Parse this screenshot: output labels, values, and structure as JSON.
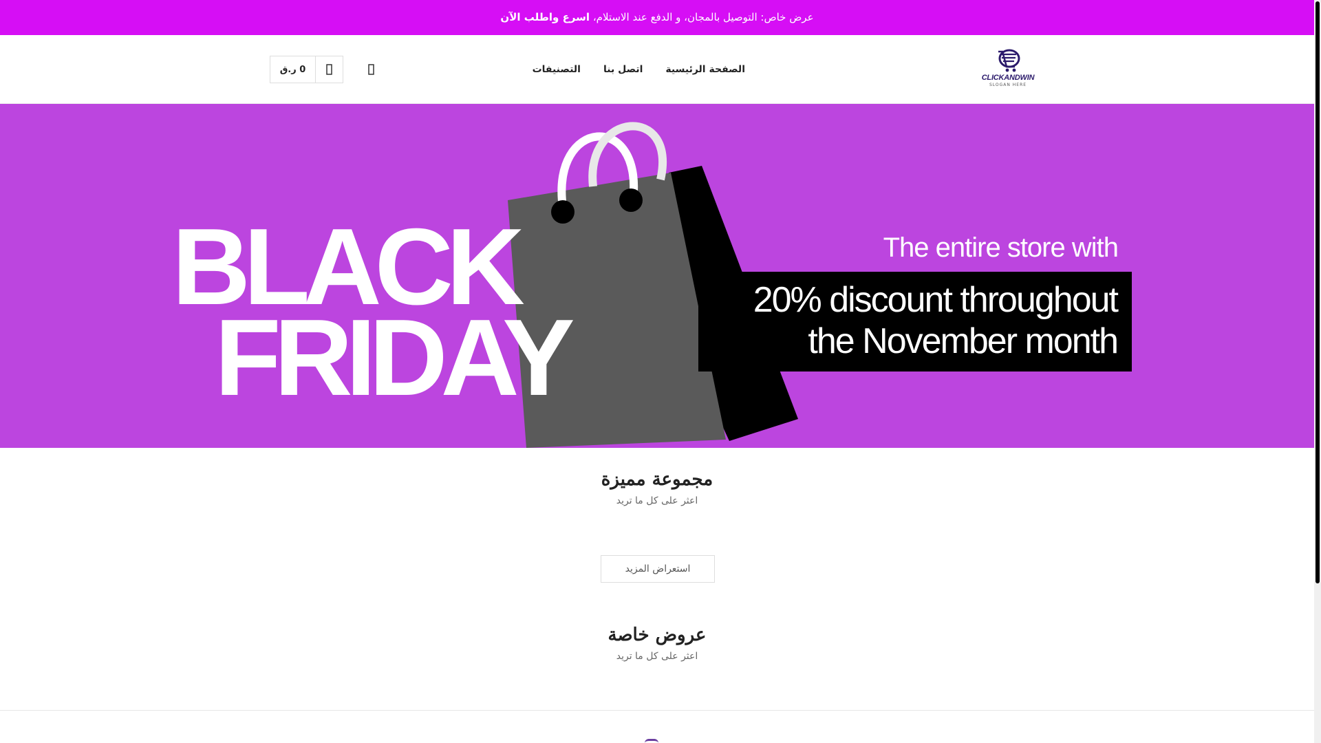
{
  "announcement": {
    "text": "عرض خاص: التوصيل بالمجان، و الدفع عند الاستلام، ",
    "cta": "اسرع واطلب الآن"
  },
  "header": {
    "logo": {
      "name": "CLICKANDWIN",
      "slogan": "SLOGAN HERE"
    },
    "nav": [
      {
        "label": "الصفحة الرئيسية"
      },
      {
        "label": "اتصل بنا"
      },
      {
        "label": "التصنيفات"
      }
    ],
    "search_icon": "search-icon",
    "cart": {
      "total": "0 ر.ق",
      "icon": "shopping-bag-icon"
    }
  },
  "banner": {
    "headline_line1": "BLACK",
    "headline_line2": "FRIDAY",
    "promo_line1": "The entire store with",
    "promo_line2": "20% discount throughout",
    "promo_line3": "the November month",
    "colors": {
      "background": "#bc45df",
      "bag_front": "#5a5a5a",
      "bag_side": "#000000"
    }
  },
  "featured": {
    "title": "مجموعة مميزة",
    "subtitle": "اعثر على كل ما تريد",
    "more_button": "استعراض المزيد"
  },
  "offers": {
    "title": "عروض خاصة",
    "subtitle": "اعثر على كل ما تريد"
  },
  "colors": {
    "accent": "#d60ef5"
  }
}
